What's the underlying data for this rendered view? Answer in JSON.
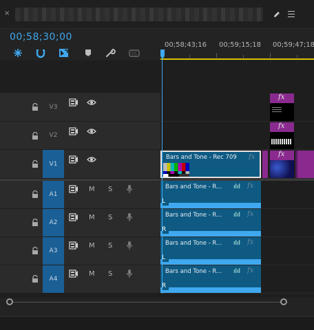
{
  "panel": {
    "title": "",
    "close_glyph": "×"
  },
  "timecode": "00;58;30;00",
  "tools": [
    {
      "name": "snap-icon",
      "color": "#3fa8ef"
    },
    {
      "name": "linked-selection-icon",
      "color": "#3fa8ef"
    },
    {
      "name": "add-marker-icon",
      "color": "#3fa8ef"
    },
    {
      "name": "marker-icon",
      "color": "#bdbdbd"
    },
    {
      "name": "wrench-icon",
      "color": "#bdbdbd"
    },
    {
      "name": "captions-icon",
      "color": "#6a6a6a"
    }
  ],
  "ruler": {
    "labels": [
      "00;58;43;16",
      "00;59;15;18",
      "00;59;47;18"
    ]
  },
  "tracks": {
    "video": [
      {
        "label": "V3",
        "active": false
      },
      {
        "label": "V2",
        "active": false
      },
      {
        "label": "V1",
        "active": true
      }
    ],
    "audio": [
      {
        "label": "A1",
        "m": "M",
        "s": "S"
      },
      {
        "label": "A2",
        "m": "M",
        "s": "S"
      },
      {
        "label": "A3",
        "m": "M",
        "s": "S"
      },
      {
        "label": "A4",
        "m": "M",
        "s": "S"
      }
    ]
  },
  "clips": {
    "video_main": "Bars and Tone - Rec 709",
    "fx": "fx",
    "audio": [
      {
        "name": "Bars and Tone - R...",
        "channel": "L"
      },
      {
        "name": "Bars and Tone - R...",
        "channel": "R"
      },
      {
        "name": "Bars and Tone - R...",
        "channel": "L"
      },
      {
        "name": "Bars and Tone - R...",
        "channel": "R"
      }
    ]
  },
  "colors": {
    "accent": "#3fa8ef",
    "clip_blue": "#0e5a82",
    "clip_purple": "#8a2a8f",
    "ruler_yellow": "#d8c200"
  }
}
